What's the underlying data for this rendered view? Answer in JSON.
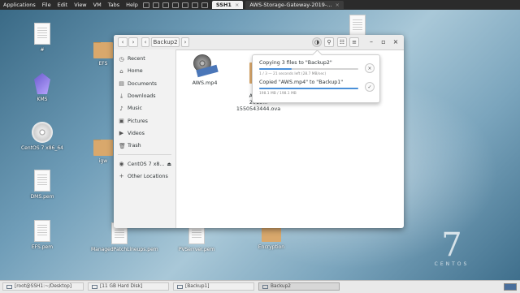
{
  "vmbar": {
    "menu": [
      "Applications",
      "File",
      "Edit",
      "View",
      "VM",
      "Tabs",
      "Help"
    ],
    "tabs": [
      {
        "label": "SSH1",
        "active": true
      },
      {
        "label": "AWS-Storage-Gateway-2019-...",
        "active": false
      }
    ]
  },
  "desktop": {
    "icons": [
      {
        "label": "#"
      },
      {
        "label": "KMS"
      },
      {
        "label": "CentOS 7 x86_64"
      },
      {
        "label": "DMS.pem"
      },
      {
        "label": "EFS.pem"
      },
      {
        "label": "EFS"
      },
      {
        "label": "igw"
      },
      {
        "label": "ManagedPatchLineups.pem"
      },
      {
        "label": "PVSerrver.pem"
      },
      {
        "label": "Encryption"
      }
    ],
    "watermark": {
      "number": "7",
      "word": "CENTOS"
    }
  },
  "files_window": {
    "path": "Backup2",
    "sidebar": [
      {
        "label": "Recent",
        "icon": "clock-icon"
      },
      {
        "label": "Home",
        "icon": "home-icon"
      },
      {
        "label": "Documents",
        "icon": "documents-icon"
      },
      {
        "label": "Downloads",
        "icon": "downloads-icon"
      },
      {
        "label": "Music",
        "icon": "music-icon"
      },
      {
        "label": "Pictures",
        "icon": "pictures-icon"
      },
      {
        "label": "Videos",
        "icon": "videos-icon"
      },
      {
        "label": "Trash",
        "icon": "trash-icon"
      },
      {
        "label": "CentOS 7 x8...",
        "icon": "disc-icon"
      },
      {
        "label": "Other Locations",
        "icon": "plus-icon"
      }
    ],
    "files": [
      {
        "name": "AWS.mp4"
      },
      {
        "name": "AWS-...\n2019...\n1550543444.ova"
      }
    ]
  },
  "operations": {
    "op1": {
      "title": "Copying 3 files to \"Backup2\"",
      "status": "1 / 3 — 21 seconds left (28.7 MB/sec)",
      "progress": 0.33
    },
    "op2": {
      "title": "Copied \"AWS.mp4\" to \"Backup1\"",
      "status": "198.1 MB / 198.1 MB",
      "progress": 1.0
    }
  },
  "taskbar": {
    "items": [
      {
        "label": "[root@SSH1:~/Desktop]",
        "active": false
      },
      {
        "label": "[11 GB Hard Disk]",
        "active": false
      },
      {
        "label": "[Backup1]",
        "active": false
      },
      {
        "label": "Backup2",
        "active": true
      }
    ]
  },
  "colors": {
    "accent": "#4a90d9",
    "vmbar": "#2b2b2b"
  }
}
